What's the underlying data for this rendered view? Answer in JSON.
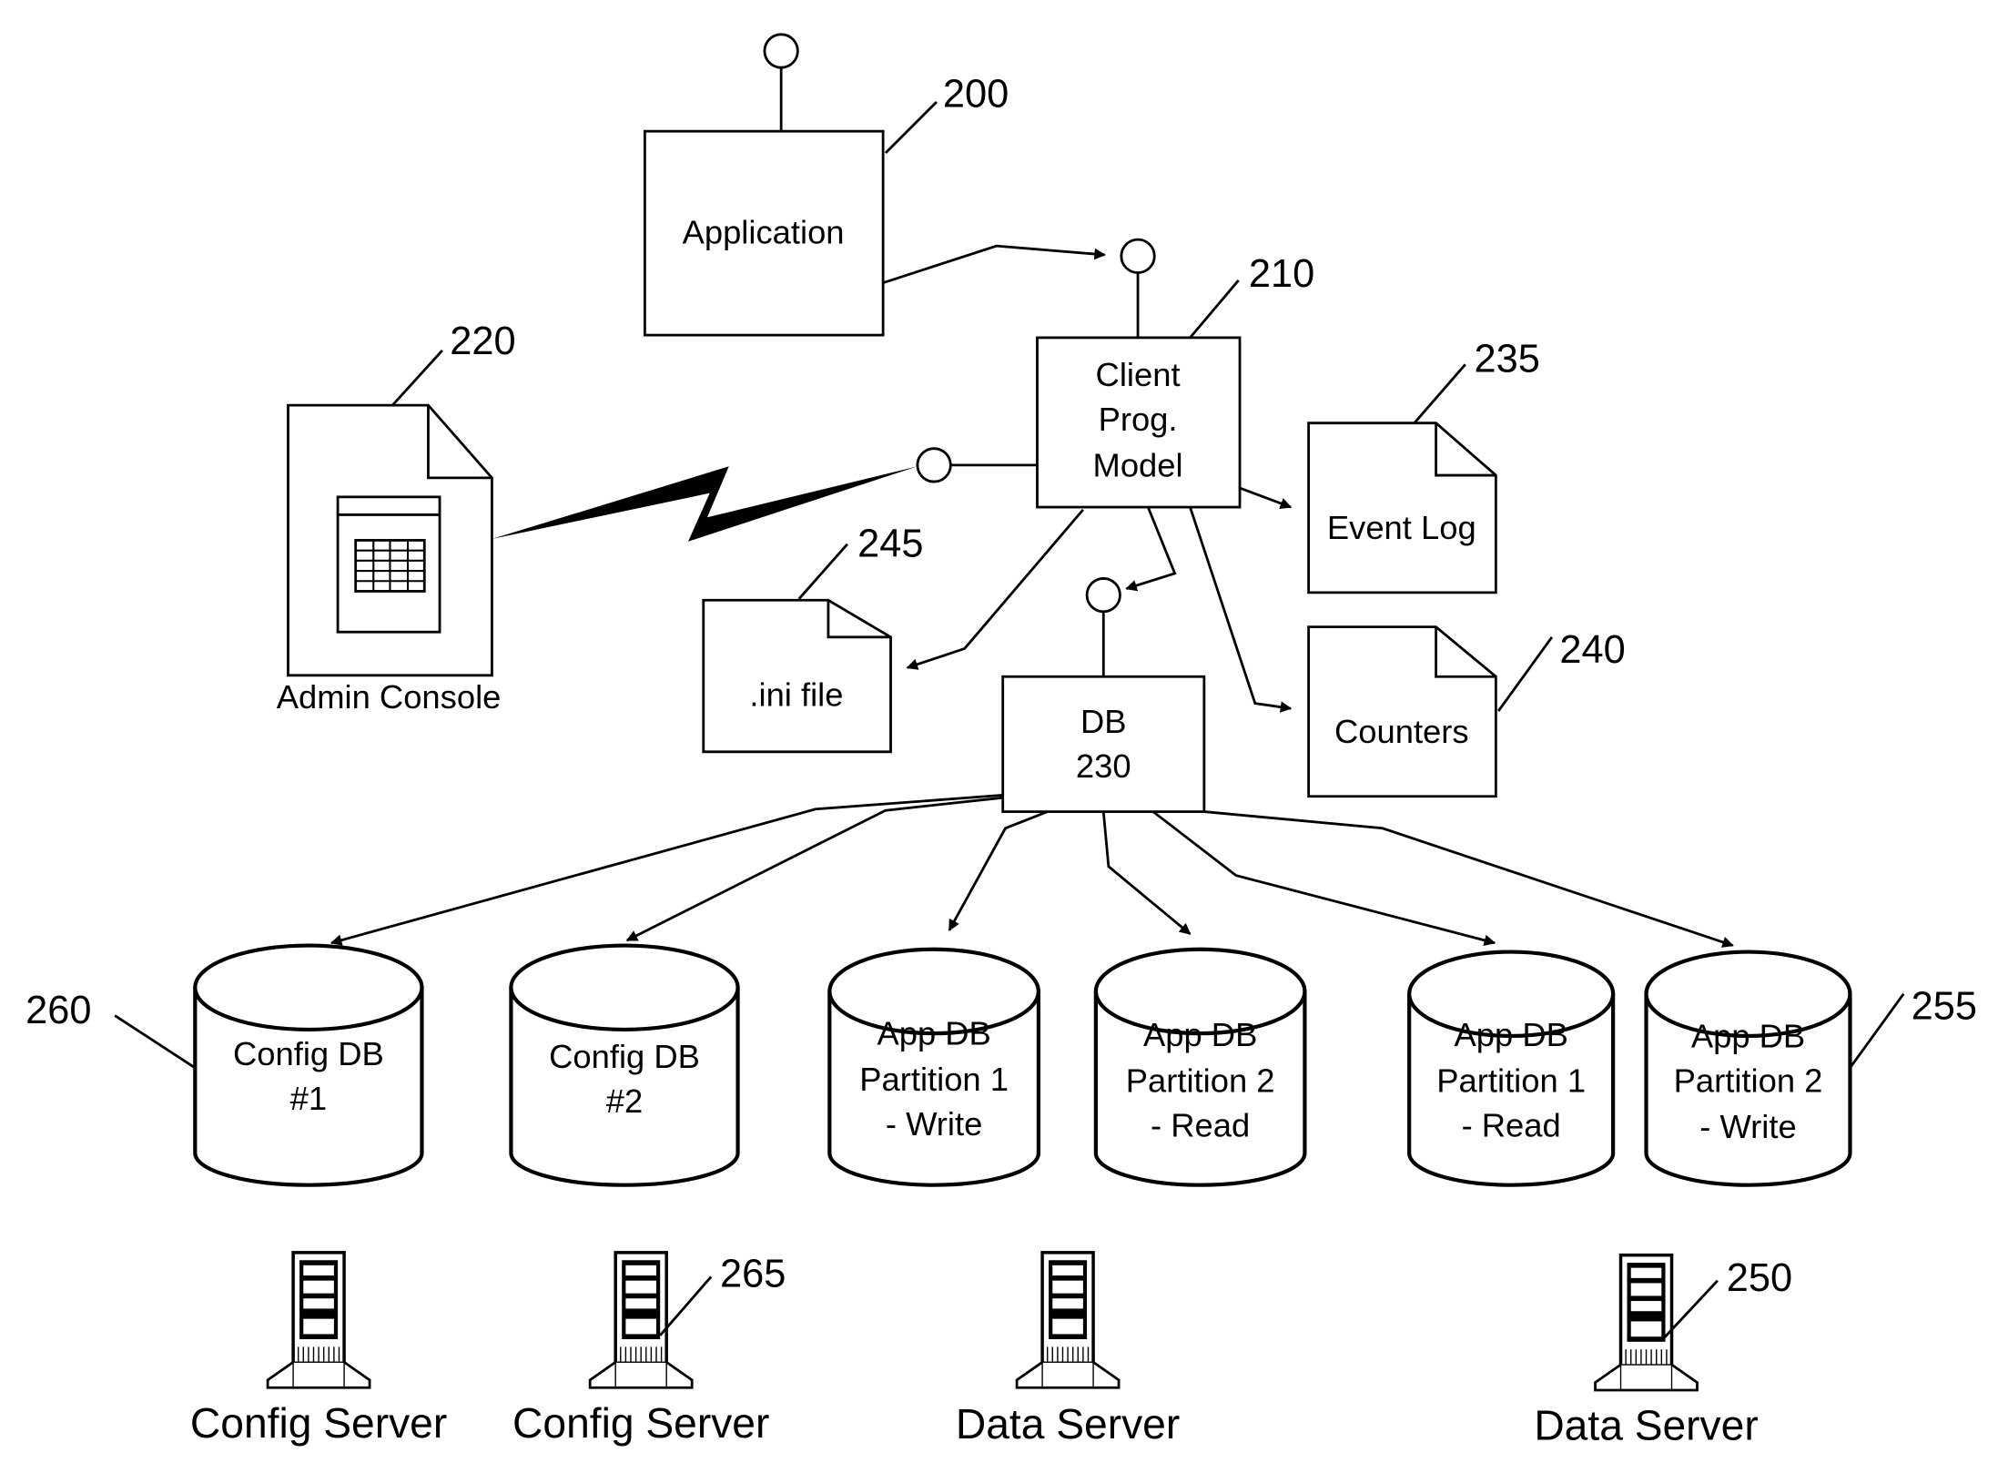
{
  "diagram": {
    "application": {
      "label": "Application",
      "ref": "200"
    },
    "client_prog_model": {
      "lines": [
        "Client",
        "Prog.",
        "Model"
      ],
      "ref": "210"
    },
    "admin_console": {
      "label": "Admin Console",
      "ref": "220"
    },
    "db": {
      "lines": [
        "DB",
        "230"
      ]
    },
    "event_log": {
      "label": "Event Log",
      "ref": "235"
    },
    "counters": {
      "label": "Counters",
      "ref": "240"
    },
    "ini_file": {
      "label": ".ini file",
      "ref": "245"
    },
    "databases": [
      {
        "lines": [
          "Config DB",
          "#1"
        ]
      },
      {
        "lines": [
          "Config DB",
          "#2"
        ]
      },
      {
        "lines": [
          "App DB",
          "Partition 1",
          "- Write"
        ]
      },
      {
        "lines": [
          "App DB",
          "Partition 2",
          "- Read"
        ]
      },
      {
        "lines": [
          "App DB",
          "Partition 1",
          "- Read"
        ]
      },
      {
        "lines": [
          "App DB",
          "Partition 2",
          "- Write"
        ]
      }
    ],
    "db_refs": {
      "config": "260",
      "app": "255"
    },
    "servers": [
      {
        "label": "Config Server"
      },
      {
        "label": "Config Server",
        "ref": "265"
      },
      {
        "label": "Data Server"
      },
      {
        "label": "Data Server",
        "ref": "250"
      }
    ]
  }
}
